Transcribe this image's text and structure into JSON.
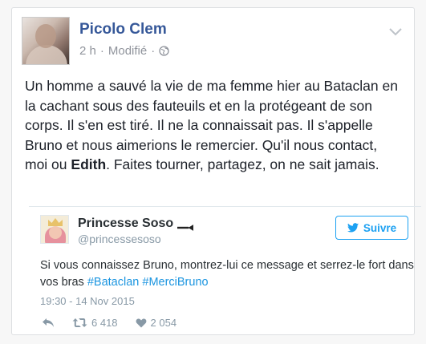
{
  "post": {
    "author": "Picolo Clem",
    "time": "2 h",
    "edited": "Modifié",
    "separator": "·",
    "body_before": "Un homme a sauvé la vie de ma femme hier au Bataclan en la cachant sous des fauteuils et en la protégeant de son corps. Il s'en est tiré. Il ne la connaissait pas. Il s'appelle Bruno et nous aimerions le remercier. Qu'il nous contact, moi ou ",
    "body_bold": "Edith",
    "body_after": ". Faites tourner, partagez, on ne sait jamais."
  },
  "tweet": {
    "name": "Princesse Soso",
    "handle": "@princessesoso",
    "follow_label": "Suivre",
    "text_plain": "Si vous connaissez Bruno, montrez-lui ce message et serrez-le fort dans vos bras ",
    "hashtag1": "#Bataclan",
    "hashtag2": "#MerciBruno",
    "date": "19:30 - 14 Nov 2015",
    "retweets": "6 418",
    "likes": "2 054"
  },
  "colors": {
    "fb_link": "#365899",
    "twitter_blue": "#1da1f2",
    "muted": "#8899a6"
  },
  "icons": [
    "globe-icon",
    "chevron-down-icon",
    "pen-icon",
    "twitter-bird-icon",
    "reply-icon",
    "retweet-icon",
    "heart-icon"
  ]
}
